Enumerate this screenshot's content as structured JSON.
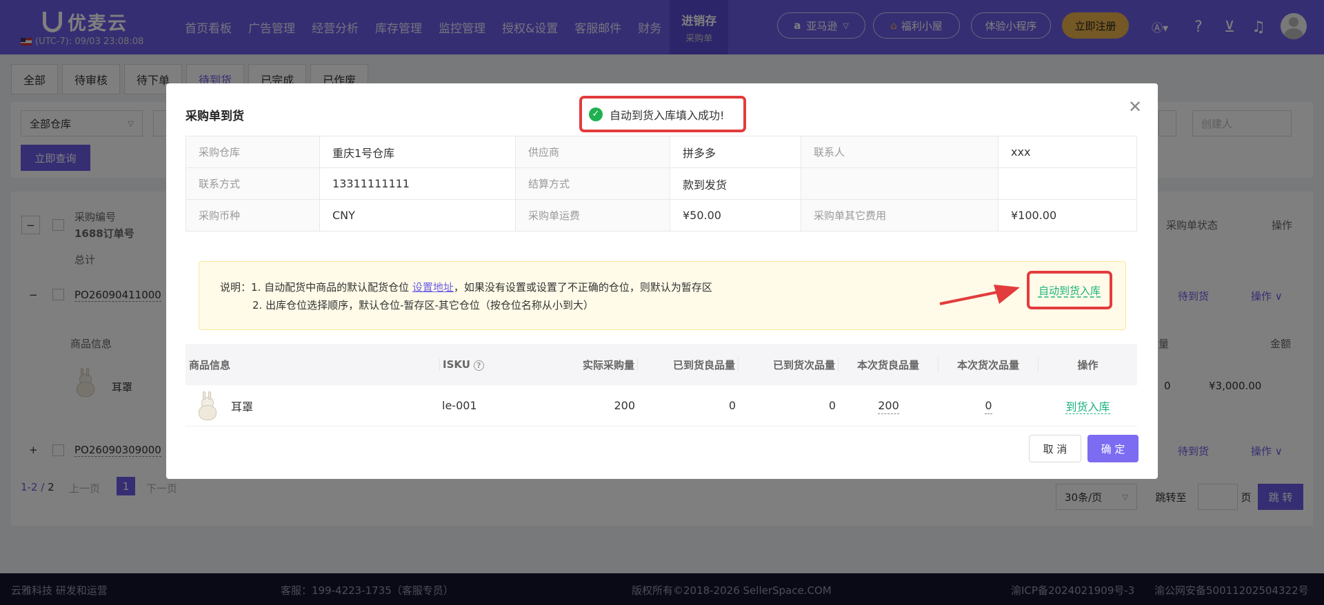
{
  "app": {
    "logo": "优麦云",
    "timezone": "(UTC-7): 09/03 23:08:08",
    "nav": [
      "首页看板",
      "广告管理",
      "经营分析",
      "库存管理",
      "监控管理",
      "授权&设置",
      "客服邮件",
      "财务"
    ],
    "nav_active": {
      "label": "进销存",
      "sub": "采购单"
    },
    "marketplace": "亚马逊",
    "pills": {
      "welfare": "福利小屋",
      "mini": "体验小程序",
      "register": "立即注册"
    },
    "icons": [
      "ai-icon",
      "help-icon",
      "cart-icon",
      "bell-icon",
      "avatar"
    ]
  },
  "background": {
    "tabs": [
      "全部",
      "待审核",
      "待下单",
      "待到货",
      "已完成",
      "已作废"
    ],
    "warehouse_select": "全部仓库",
    "creator_placeholder": "创建人",
    "query_button": "立即查询",
    "header": {
      "po_no": "采购编号",
      "order_1688": "1688订单号",
      "total": "总计",
      "status": "采购单状态",
      "ops": "操作"
    },
    "rows": [
      {
        "po": "PO26090411000",
        "status": "待到货",
        "op": "操作"
      },
      {
        "po": "PO26090309000",
        "status": "待到货",
        "op": "操作"
      }
    ],
    "sub_header": {
      "goods": "商品信息",
      "qty": "量",
      "amount": "金额"
    },
    "sub_row": {
      "name": "耳罩",
      "qty": "0",
      "amount": "¥3,000.00"
    },
    "pagination": {
      "range": "1-2",
      "total": "2",
      "prev": "上一页",
      "page": "1",
      "next": "下一页",
      "per_page": "30条/页",
      "jump_label": "跳转至",
      "page_unit": "页",
      "jump_button": "跳 转"
    }
  },
  "footer": {
    "company": "云雅科技 研发和运营",
    "service": "客服：199-4223-1735（客服专员）",
    "copyright": "版权所有©2018-2026 SellerSpace.COM",
    "icp": "渝ICP备2024021909号-3",
    "police": "渝公网安备50011202504322号"
  },
  "modal": {
    "title": "采购单到货",
    "info": [
      [
        {
          "label": "采购仓库",
          "value": "重庆1号仓库"
        },
        {
          "label": "供应商",
          "value": "拼多多"
        },
        {
          "label": "联系人",
          "value": "xxx"
        }
      ],
      [
        {
          "label": "联系方式",
          "value": "13311111111"
        },
        {
          "label": "结算方式",
          "value": "款到发货"
        },
        {
          "label": "",
          "value": ""
        }
      ],
      [
        {
          "label": "采购币种",
          "value": "CNY"
        },
        {
          "label": "采购单运费",
          "value": "¥50.00"
        },
        {
          "label": "采购单其它费用",
          "value": "¥100.00"
        }
      ]
    ],
    "notice": {
      "prefix": "说明：",
      "line1_a": "1. 自动配货中商品的默认配货仓位 ",
      "line1_link": "设置地址",
      "line1_b": "，如果没有设置或设置了不正确的仓位，则默认为暂存区",
      "line2": "2. 出库仓位选择顺序，默认仓位-暂存区-其它仓位（按仓位名称从小到大）"
    },
    "auto_button": "自动到货入库",
    "columns": [
      "商品信息",
      "ISKU",
      "实际采购量",
      "已到货良品量",
      "已到货次品量",
      "本次货良品量",
      "本次货次品量",
      "操作"
    ],
    "row": {
      "name": "耳罩",
      "isku": "le-001",
      "qty": "200",
      "arrived_good": "0",
      "arrived_bad": "0",
      "this_good": "200",
      "this_bad": "0",
      "action": "到货入库"
    },
    "cancel": "取 消",
    "confirm": "确 定"
  },
  "toast": "自动到货入库填入成功!"
}
